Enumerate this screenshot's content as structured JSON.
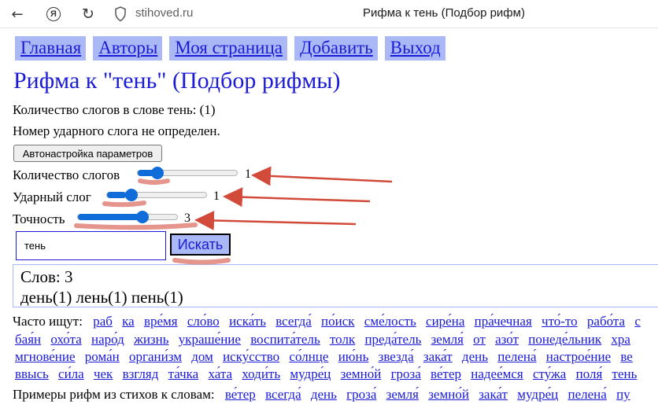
{
  "browser": {
    "domain": "stihoved.ru",
    "tab_title": "Рифма к тень (Подбор рифм)",
    "yandex_letter": "Я"
  },
  "menu": {
    "items": [
      "Главная",
      "Авторы",
      "Моя страница",
      "Добавить",
      "Выход"
    ]
  },
  "heading": "Рифма к \"тень\" (Подбор рифмы)",
  "info": {
    "syllables": "Количество слогов в слове тень: (1)",
    "stress": "Номер ударного слога не определен."
  },
  "auto_button": "Автонастройка параметров",
  "sliders": [
    {
      "label": "Количество слогов",
      "value": "1",
      "level": 0.2
    },
    {
      "label": "Ударный слог",
      "value": "1",
      "level": 0.2
    },
    {
      "label": "Точность",
      "value": "3",
      "level": 0.65
    }
  ],
  "search": {
    "value": "тень",
    "button": "Искать"
  },
  "result": {
    "count": "Слов: 3",
    "words": "день(1) лень(1) пень(1)"
  },
  "popular": {
    "label": "Часто ищут:",
    "row1": [
      "раб",
      "ка",
      "вре́мя",
      "сло́во",
      "иска́ть",
      "всегда́",
      "по́иск",
      "сме́лость",
      "сире́на",
      "пра́чечная",
      "что́-то",
      "рабо́та",
      "с"
    ],
    "row2": [
      "бая́н",
      "охо́та",
      "наро́д",
      "жизнь",
      "украше́ние",
      "воспита́тель",
      "толк",
      "преда́тель",
      "земля́",
      "от",
      "азо́т",
      "понеде́льник",
      "хра"
    ],
    "row3": [
      "мгнове́ние",
      "рома́н",
      "органи́зм",
      "дом",
      "иску́сство",
      "со́лнце",
      "ию́нь",
      "звезда́",
      "зака́т",
      "день",
      "пелена́",
      "настрое́ние",
      "ве"
    ],
    "row4": [
      "ввысь",
      "си́ла",
      "чек",
      "взгляд",
      "та́чка",
      "ха́та",
      "ходи́ть",
      "мудре́ц",
      "земно́й",
      "гроза́",
      "ве́тер",
      "надее́мся",
      "сту́жа",
      "поля́",
      "тень"
    ]
  },
  "examples": {
    "label": "Примеры рифм из стихов к словам:",
    "words": [
      "ве́тер",
      "всегда́",
      "день",
      "гроза́",
      "земля́",
      "земно́й",
      "зака́т",
      "мудре́ц",
      "пелена́",
      "пу"
    ]
  },
  "colors": {
    "link": "#1b1bd6",
    "menu_bg": "#aab9f5",
    "slider": "#0f6cd9",
    "annotation": "#d24a3a"
  }
}
